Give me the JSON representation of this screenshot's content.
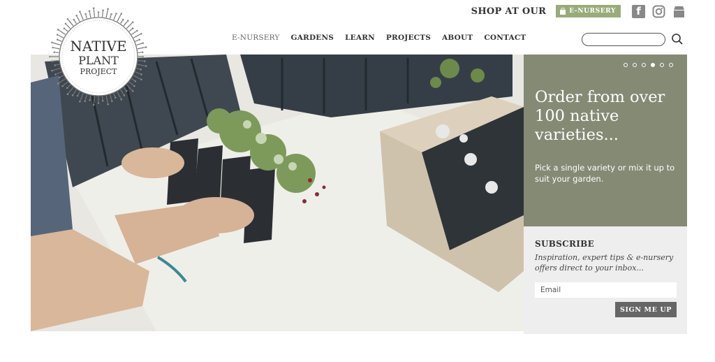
{
  "logo": {
    "line1": "NATIVE",
    "line2": "PLANT",
    "line3": "PROJECT"
  },
  "topbar": {
    "shop_label": "SHOP AT OUR",
    "enursery_label": "E-NURSERY",
    "icons": [
      "facebook-icon",
      "instagram-icon",
      "shop-icon"
    ]
  },
  "nav": {
    "items": [
      "E-NURSERY",
      "GARDENS",
      "LEARN",
      "PROJECTS",
      "ABOUT",
      "CONTACT"
    ]
  },
  "search": {
    "placeholder": "",
    "value": ""
  },
  "hero": {
    "image": "hands packing native plant tubestock into a cardboard box"
  },
  "carousel": {
    "slide_count": 6,
    "active_slide": 4
  },
  "side": {
    "headline": "Order from over 100 native varieties...",
    "subtext": "Pick a single variety or mix it up to suit your garden."
  },
  "subscribe": {
    "title": "SUBSCRIBE",
    "text": "Inspiration, expert tips & e-nursery offers direct to your inbox...",
    "email_placeholder": "Email",
    "button_label": "SIGN ME UP"
  },
  "colors": {
    "accent_green": "#9aab7a",
    "panel_olive": "#858a75",
    "subscribe_bg": "#eeeeee",
    "button_grey": "#666666"
  }
}
